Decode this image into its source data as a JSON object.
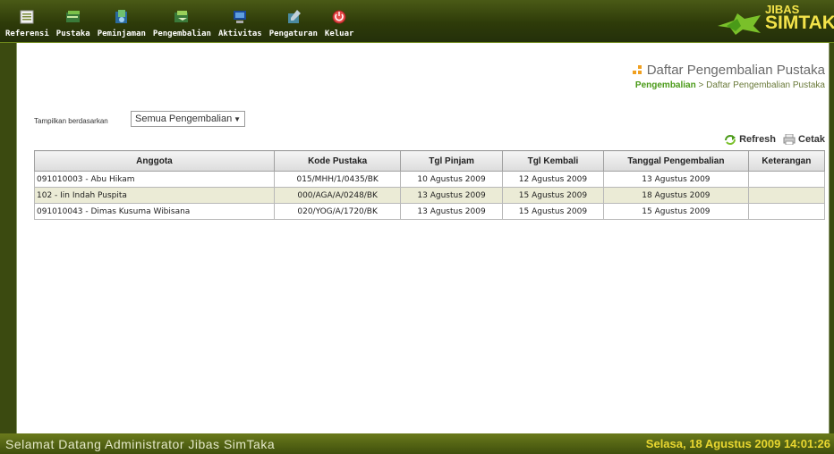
{
  "nav": [
    {
      "label": "Referensi",
      "icon": "referensi-icon"
    },
    {
      "label": "Pustaka",
      "icon": "pustaka-icon"
    },
    {
      "label": "Peminjaman",
      "icon": "peminjaman-icon"
    },
    {
      "label": "Pengembalian",
      "icon": "pengembalian-icon"
    },
    {
      "label": "Aktivitas",
      "icon": "aktivitas-icon"
    },
    {
      "label": "Pengaturan",
      "icon": "pengaturan-icon"
    },
    {
      "label": "Keluar",
      "icon": "keluar-icon"
    }
  ],
  "logo": {
    "top": "JIBAS",
    "main": "SIMTAKA"
  },
  "page": {
    "title": "Daftar Pengembalian Pustaka",
    "breadcrumb_link": "Pengembalian",
    "breadcrumb_sep": " > ",
    "breadcrumb_current": "Daftar Pengembalian Pustaka"
  },
  "filter": {
    "label": "Tampilkan berdasarkan",
    "selected": "Semua Pengembalian"
  },
  "actions": {
    "refresh": "Refresh",
    "print": "Cetak"
  },
  "table": {
    "headers": [
      "Anggota",
      "Kode Pustaka",
      "Tgl Pinjam",
      "Tgl Kembali",
      "Tanggal Pengembalian",
      "Keterangan"
    ],
    "rows": [
      [
        "091010003 - Abu Hikam",
        "015/MHH/1/0435/BK",
        "10 Agustus 2009",
        "12 Agustus 2009",
        "13 Agustus 2009",
        ""
      ],
      [
        "102 - Iin Indah Puspita",
        "000/AGA/A/0248/BK",
        "13 Agustus 2009",
        "15 Agustus 2009",
        "18 Agustus 2009",
        ""
      ],
      [
        "091010043 - Dimas Kusuma Wibisana",
        "020/YOG/A/1720/BK",
        "13 Agustus 2009",
        "15 Agustus 2009",
        "15 Agustus 2009",
        ""
      ]
    ]
  },
  "status": {
    "welcome": "Selamat Datang Administrator Jibas SimTaka",
    "datetime": "Selasa, 18 Agustus 2009 14:01:26"
  },
  "colors": {
    "accent": "#4a9a18",
    "topbar": "#2e3b09",
    "datetime": "#e8d630"
  }
}
